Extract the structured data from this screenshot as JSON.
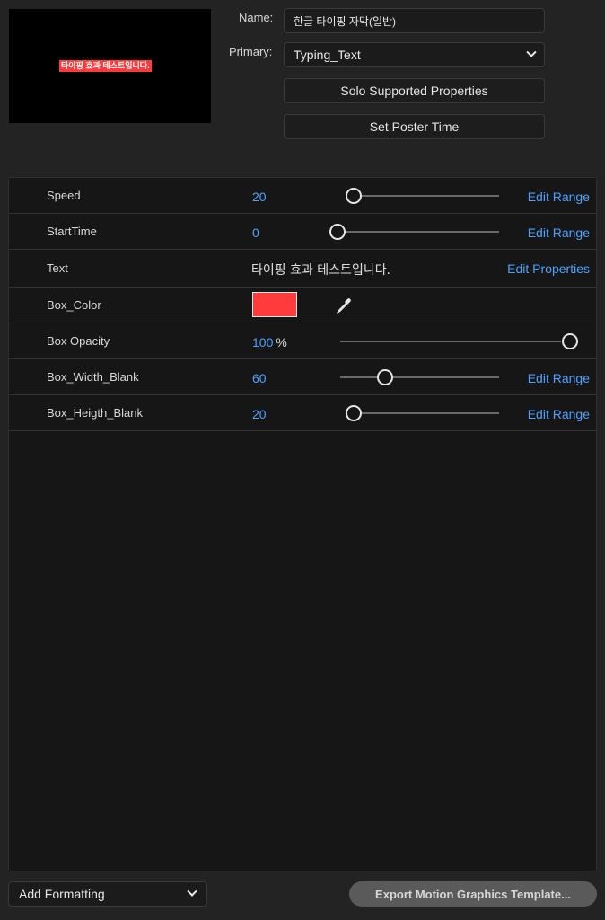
{
  "preview": {
    "caption": "타이핑 효과 테스트입니다."
  },
  "name": {
    "label": "Name:",
    "value": "한글 타이핑 자막(일반)"
  },
  "primary": {
    "label": "Primary:",
    "value": "Typing_Text"
  },
  "buttons": {
    "solo": "Solo Supported Properties",
    "poster": "Set Poster Time"
  },
  "properties": [
    {
      "name": "Speed",
      "value": "20",
      "slider": 0.0,
      "action": "Edit Range"
    },
    {
      "name": "StartTime",
      "value": "0",
      "slider": 0.0,
      "action": "Edit Range"
    },
    {
      "name": "Text",
      "text": "타이핑 효과 테스트입니다.",
      "action": "Edit Properties"
    },
    {
      "name": "Box_Color",
      "color": "#ff3b3b"
    },
    {
      "name": "Box Opacity",
      "value": "100",
      "unit": "%",
      "slider": 1.0
    },
    {
      "name": "Box_Width_Blank",
      "value": "60",
      "slider": 0.2,
      "action": "Edit Range"
    },
    {
      "name": "Box_Heigth_Blank",
      "value": "20",
      "slider": 0.0,
      "action": "Edit Range"
    }
  ],
  "bottom": {
    "add_formatting": "Add Formatting",
    "export": "Export Motion Graphics Template..."
  },
  "colors": {
    "accent": "#4aa3ff",
    "swatch": "#ff3b3b"
  }
}
